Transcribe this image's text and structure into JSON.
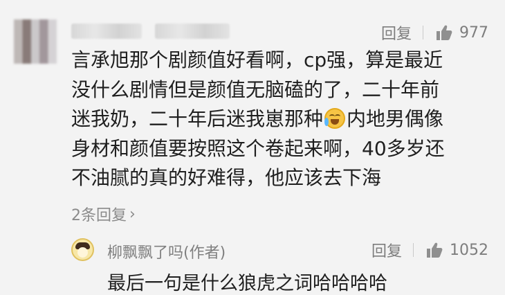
{
  "comment": {
    "reply_label": "回复",
    "likes": "977",
    "text_parts": [
      "言承旭那个剧颜值好看啊，cp强，算是最近\n没什么剧情但是颜值无脑磕的了，二十年前\n迷我奶，二十年后迷我崽那种",
      "内地男偶像\n身材和颜值要按照这个卷起来啊，40多岁还\n不油腻的真的好难得，他应该去下海"
    ],
    "emoji": "grinning-with-sweat-emoji",
    "replies_link": "2条回复",
    "replies_chevron": "›"
  },
  "reply": {
    "author": "柳飘飘了吗(作者)",
    "reply_label": "回复",
    "likes": "1052",
    "text": "最后一句是什么狼虎之词哈哈哈哈"
  },
  "colors": {
    "background": "#f3f3f3",
    "text": "#1f1f1f",
    "meta": "#7d7d7d",
    "thumb": "#8f8f8f"
  }
}
